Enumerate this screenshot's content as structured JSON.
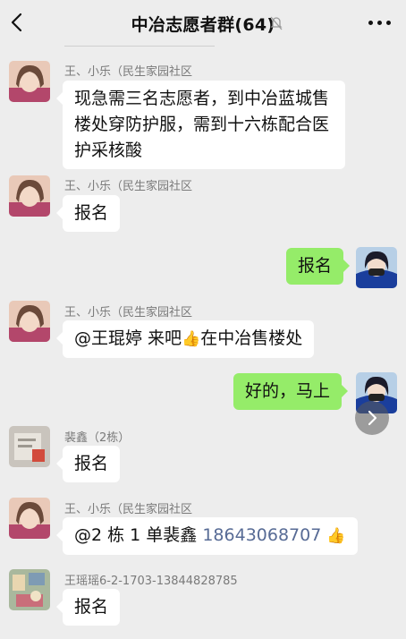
{
  "header": {
    "title": "中冶志愿者群(64)",
    "back_icon": "chevron-left-icon",
    "mute_icon": "bell-off-icon",
    "more_icon": "more-dots-icon"
  },
  "messages": [
    {
      "sender": "王、小乐（民生家园社区",
      "text": "现急需三名志愿者，到中冶蓝城售楼处穿防护服，需到十六栋配合医护采核酸",
      "side": "left"
    },
    {
      "sender": "王、小乐（民生家园社区",
      "text": "报名",
      "side": "left"
    },
    {
      "sender": "",
      "text": "报名",
      "side": "right"
    },
    {
      "sender": "王、小乐（民生家园社区",
      "text_before": "@王琨婷  来吧",
      "emoji": "👍",
      "text_after": "在中冶售楼处",
      "side": "left"
    },
    {
      "sender": "",
      "text": "好的，马上",
      "side": "right"
    },
    {
      "sender": "裴鑫（2栋）",
      "text": "报名",
      "side": "left"
    },
    {
      "sender": "王、小乐（民生家园社区",
      "text_before": "@2 栋 1 单裴鑫 ",
      "phone": "18643068707",
      "emoji": "👍",
      "side": "left"
    },
    {
      "sender": "王瑶瑶6-2-1703-13844828785",
      "text": "报名",
      "side": "left"
    }
  ],
  "colors": {
    "background": "#ededed",
    "own_bubble": "#95ec69",
    "other_bubble": "#ffffff",
    "link": "#576b95"
  }
}
